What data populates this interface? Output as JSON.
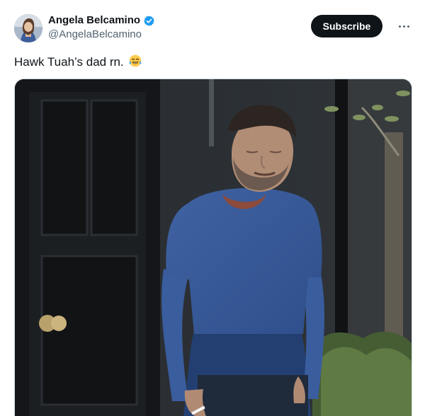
{
  "author": {
    "display_name": "Angela Belcamino",
    "handle": "@AngelaBelcamino",
    "avatar_icon": "profile-photo",
    "verified_icon": "verified-badge-icon",
    "verified_color": "#1d9bf0"
  },
  "actions": {
    "subscribe_label": "Subscribe",
    "more_icon": "more-horizontal-icon"
  },
  "post": {
    "text": "Hawk Tuah’s dad rn.",
    "emoji_icon": "face-with-tears-of-joy-icon"
  },
  "media": {
    "type": "photo",
    "subject": "man in blue sweater standing by a black door with eyes closed, holding a cigarette"
  },
  "colors": {
    "text_primary": "#0f1419",
    "text_secondary": "#536471",
    "button_bg": "#0f1419",
    "button_text": "#ffffff"
  }
}
